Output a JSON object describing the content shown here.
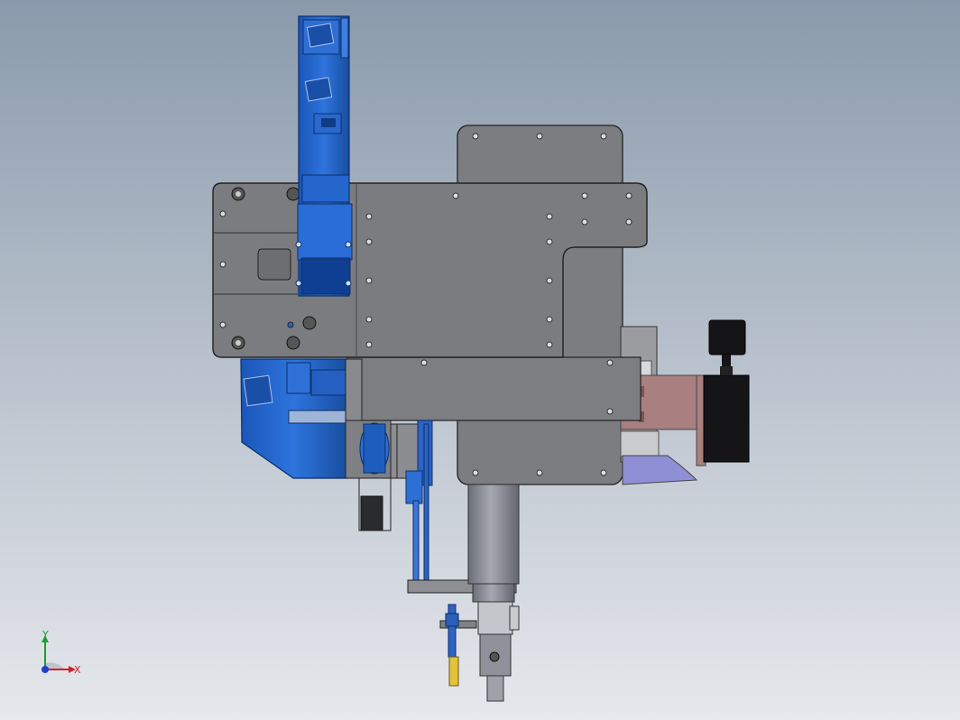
{
  "viewport": {
    "background_top": "#8a9aac",
    "background_bottom": "#e6e8ec"
  },
  "model": {
    "colors": {
      "plate": "#7b7c7f",
      "plate_edge": "#2a2b2d",
      "plate_light": "#8d8e91",
      "blue_part": "#1f62c9",
      "blue_dark": "#123f8a",
      "cylinder": "#8a8d96",
      "pink_bracket": "#a97f7f",
      "motor_black": "#151517",
      "lavender": "#8f8fd6",
      "yellow_sensor": "#e2c33a"
    }
  },
  "triad": {
    "x_label": "X",
    "y_label": "Y",
    "x_color": "#d3202a",
    "y_color": "#1aa12d",
    "z_color": "#2040c8"
  }
}
